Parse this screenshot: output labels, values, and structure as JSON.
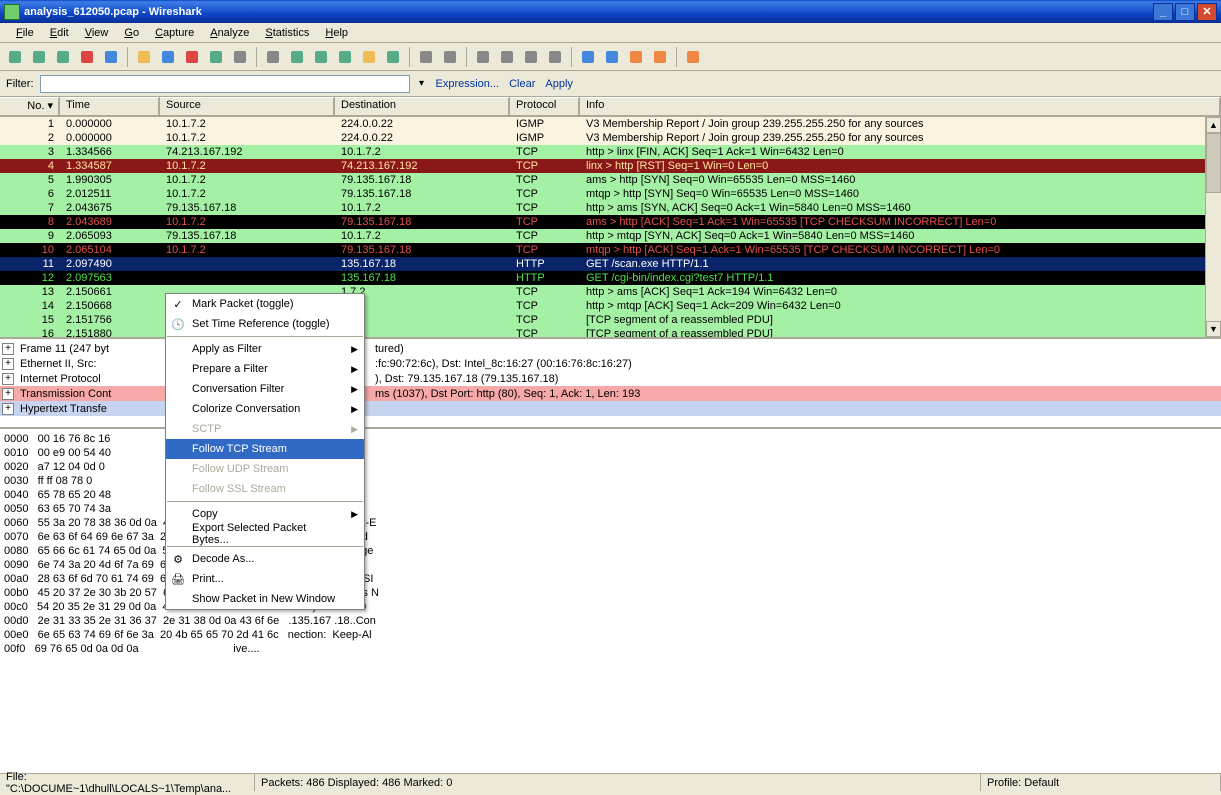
{
  "window": {
    "title": "analysis_612050.pcap - Wireshark"
  },
  "menu": [
    "File",
    "Edit",
    "View",
    "Go",
    "Capture",
    "Analyze",
    "Statistics",
    "Help"
  ],
  "menu_ul": [
    "F",
    "E",
    "V",
    "G",
    "C",
    "A",
    "S",
    "H"
  ],
  "filterbar": {
    "label": "Filter:",
    "value": "",
    "expression": "Expression...",
    "clear": "Clear",
    "apply": "Apply"
  },
  "columns": [
    "No. ▾",
    "Time",
    "Source",
    "Destination",
    "Protocol",
    "Info"
  ],
  "packets": [
    {
      "no": "1",
      "time": "0.000000",
      "src": "10.1.7.2",
      "dst": "224.0.0.22",
      "proto": "IGMP",
      "info": "V3 Membership Report / Join group 239.255.255.250 for any sources",
      "cls": "bg-ivory"
    },
    {
      "no": "2",
      "time": "0.000000",
      "src": "10.1.7.2",
      "dst": "224.0.0.22",
      "proto": "IGMP",
      "info": "V3 Membership Report / Join group 239.255.255.250 for any sources",
      "cls": "bg-ivory"
    },
    {
      "no": "3",
      "time": "1.334566",
      "src": "74.213.167.192",
      "dst": "10.1.7.2",
      "proto": "TCP",
      "info": "http > linx [FIN, ACK] Seq=1 Ack=1 Win=6432 Len=0",
      "cls": "bg-green"
    },
    {
      "no": "4",
      "time": "1.334587",
      "src": "10.1.7.2",
      "dst": "74.213.167.192",
      "proto": "TCP",
      "info": "linx > http [RST] Seq=1 Win=0 Len=0",
      "cls": "bg-darkred"
    },
    {
      "no": "5",
      "time": "1.990305",
      "src": "10.1.7.2",
      "dst": "79.135.167.18",
      "proto": "TCP",
      "info": "ams > http [SYN] Seq=0 Win=65535 Len=0 MSS=1460",
      "cls": "bg-green"
    },
    {
      "no": "6",
      "time": "2.012511",
      "src": "10.1.7.2",
      "dst": "79.135.167.18",
      "proto": "TCP",
      "info": "mtqp > http [SYN] Seq=0 Win=65535 Len=0 MSS=1460",
      "cls": "bg-green"
    },
    {
      "no": "7",
      "time": "2.043675",
      "src": "79.135.167.18",
      "dst": "10.1.7.2",
      "proto": "TCP",
      "info": "http > ams [SYN, ACK] Seq=0 Ack=1 Win=5840 Len=0 MSS=1460",
      "cls": "bg-green"
    },
    {
      "no": "8",
      "time": "2.043689",
      "src": "10.1.7.2",
      "dst": "79.135.167.18",
      "proto": "TCP",
      "info": "ams > http [ACK] Seq=1 Ack=1 Win=65535 [TCP CHECKSUM INCORRECT] Len=0",
      "cls": "bg-black-red"
    },
    {
      "no": "9",
      "time": "2.065093",
      "src": "79.135.167.18",
      "dst": "10.1.7.2",
      "proto": "TCP",
      "info": "http > mtqp [SYN, ACK] Seq=0 Ack=1 Win=5840 Len=0 MSS=1460",
      "cls": "bg-green"
    },
    {
      "no": "10",
      "time": "2.065104",
      "src": "10.1.7.2",
      "dst": "79.135.167.18",
      "proto": "TCP",
      "info": "mtqp > http [ACK] Seq=1 Ack=1 Win=65535 [TCP CHECKSUM INCORRECT] Len=0",
      "cls": "bg-black-red"
    },
    {
      "no": "11",
      "time": "2.097490",
      "src": "",
      "dst": "135.167.18",
      "proto": "HTTP",
      "info": "GET /scan.exe HTTP/1.1",
      "cls": "bg-navy"
    },
    {
      "no": "12",
      "time": "2.097563",
      "src": "",
      "dst": "135.167.18",
      "proto": "HTTP",
      "info": "GET /cgi-bin/index.cgi?test7 HTTP/1.1",
      "cls": "bg-black-green"
    },
    {
      "no": "13",
      "time": "2.150661",
      "src": "",
      "dst": "1.7.2",
      "proto": "TCP",
      "info": "http > ams [ACK] Seq=1 Ack=194 Win=6432 Len=0",
      "cls": "bg-green"
    },
    {
      "no": "14",
      "time": "2.150668",
      "src": "",
      "dst": "1.7.2",
      "proto": "TCP",
      "info": "http > mtqp [ACK] Seq=1 Ack=209 Win=6432 Len=0",
      "cls": "bg-green"
    },
    {
      "no": "15",
      "time": "2.151756",
      "src": "",
      "dst": "1.7.2",
      "proto": "TCP",
      "info": "[TCP segment of a reassembled PDU]",
      "cls": "bg-green"
    },
    {
      "no": "16",
      "time": "2.151880",
      "src": "",
      "dst": "1.7.2",
      "proto": "TCP",
      "info": "[TCP segment of a reassembled PDU]",
      "cls": "bg-green"
    }
  ],
  "details": [
    {
      "txt": "Frame 11 (247 byt",
      "tail": "tured)",
      "cls": ""
    },
    {
      "txt": "Ethernet II, Src:",
      "tail": ":fc:90:72:6c), Dst: Intel_8c:16:27 (00:16:76:8c:16:27)",
      "cls": ""
    },
    {
      "txt": "Internet Protocol",
      "tail": "), Dst: 79.135.167.18 (79.135.167.18)",
      "cls": ""
    },
    {
      "txt": "Transmission Cont",
      "tail": "ms (1037), Dst Port: http (80), Seq: 1, Ack: 1, Len: 193",
      "cls": "sel"
    },
    {
      "txt": "Hypertext Transfe",
      "tail": "",
      "cls": "selblue"
    }
  ],
  "hex": [
    "0000   00 16 76 8c 16                                8 00 45 00   ..v... ..rl..E.",
    "0010   00 e9 00 54 40                                9 02 4f 87   ...T@. ......O.",
    "0020   a7 12 04 0d 0                                 . cd 50 18   .....P - b....P.",
    "0030   ff ff 08 78 0                                 8 61 6e 2e   ...x.. GE T /scan.",
    "0040   65 78 65 20 48                                d 0a 41 63   exe HTTP /1.1..Ac",
    "0050   63 65 70 74 3a                                4 2d 43 50   cept: */ *..UA-CP",
    "0060   55 3a 20 78 38 36 0d 0a  41 63 63 65 70 74 2d 45   U: x86.. Accept-E",
    "0070   6e 63 6f 64 69 6e 67 3a  20 67 7a 69 70 2c 20 64   ncoding:  gzip, d",
    "0080   65 66 6c 61 74 65 0d 0a  55 73 65 72 2d 41 67 65   eflate.. User-Age",
    "0090   6e 74 3a 20 4d 6f 7a 69  6c 6c 61 2f 34 2e 30 20   nt: Mozi lla/4.0 ",
    "00a0   28 63 6f 6d 70 61 74 69  62 6c 65 3b 20 4d 53 49   (compati ble; MSI",
    "00b0   45 20 37 2e 30 3b 20 57  69 6e 64 6f 77 73 20 4e   E 7.0; W indows N",
    "00c0   54 20 35 2e 31 29 0d 0a  48 6f 73 74 3a 20 37 39   T 5.1).. Host: 79",
    "00d0   2e 31 33 35 2e 31 36 37  2e 31 38 0d 0a 43 6f 6e   .135.167 .18..Con",
    "00e0   6e 65 63 74 69 6f 6e 3a  20 4b 65 65 70 2d 41 6c   nection:  Keep-Al",
    "00f0   69 76 65 0d 0a 0d 0a                               ive.... "
  ],
  "context": [
    {
      "label": "Mark Packet (toggle)",
      "icon": "✓",
      "type": "item"
    },
    {
      "label": "Set Time Reference (toggle)",
      "icon": "🕓",
      "type": "item"
    },
    {
      "type": "sep"
    },
    {
      "label": "Apply as Filter",
      "type": "sub"
    },
    {
      "label": "Prepare a Filter",
      "type": "sub"
    },
    {
      "label": "Conversation Filter",
      "type": "sub"
    },
    {
      "label": "Colorize Conversation",
      "type": "sub"
    },
    {
      "label": "SCTP",
      "type": "sub",
      "dis": true
    },
    {
      "label": "Follow TCP Stream",
      "type": "item",
      "sel": true
    },
    {
      "label": "Follow UDP Stream",
      "type": "item",
      "dis": true
    },
    {
      "label": "Follow SSL Stream",
      "type": "item",
      "dis": true
    },
    {
      "type": "sep"
    },
    {
      "label": "Copy",
      "type": "sub"
    },
    {
      "label": "Export Selected Packet Bytes...",
      "type": "item"
    },
    {
      "type": "sep"
    },
    {
      "label": "Decode As...",
      "icon": "⚙",
      "type": "item"
    },
    {
      "label": "Print...",
      "icon": "🖨",
      "type": "item"
    },
    {
      "label": "Show Packet in New Window",
      "type": "item"
    }
  ],
  "status": {
    "path": "File: \"C:\\DOCUME~1\\dhull\\LOCALS~1\\Temp\\ana...",
    "packets": "Packets: 486 Displayed: 486 Marked: 0",
    "profile": "Profile: Default"
  },
  "toolbar_icons": [
    "list",
    "capture",
    "capture-options",
    "stop",
    "restart",
    "sep",
    "open",
    "save",
    "close",
    "reload",
    "print",
    "sep",
    "find",
    "back",
    "forward",
    "jump",
    "go-first",
    "go-last",
    "sep",
    "colorize",
    "auto-scroll",
    "sep",
    "zoom-in",
    "zoom-out",
    "zoom-100",
    "resize-cols",
    "sep",
    "capture-filters",
    "display-filters",
    "coloring-rules",
    "prefs",
    "sep",
    "help"
  ]
}
